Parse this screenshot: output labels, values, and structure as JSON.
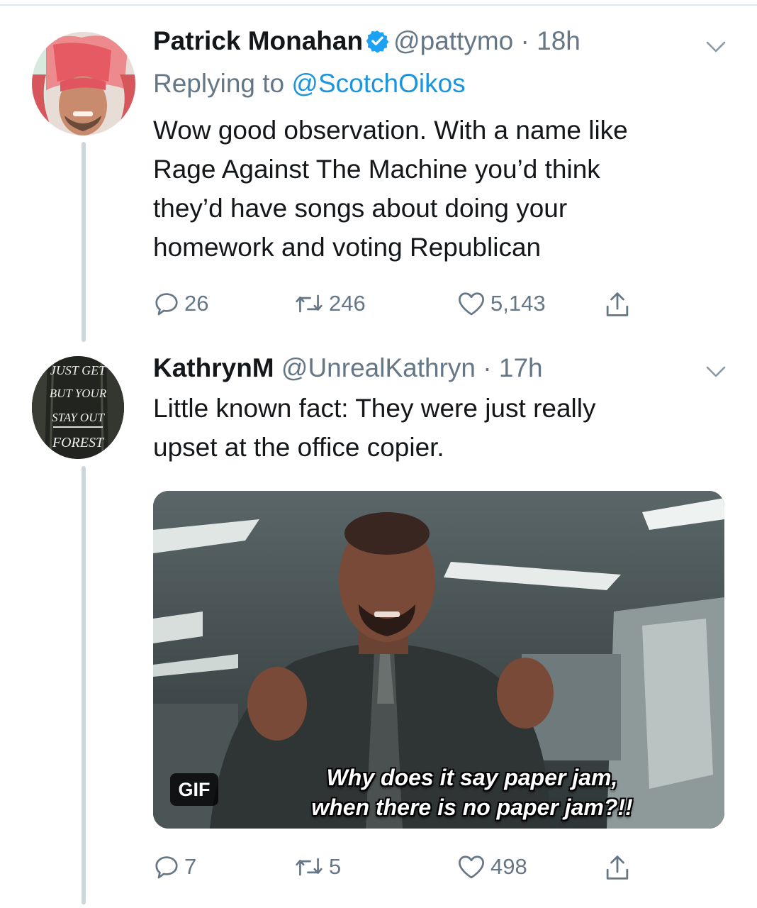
{
  "tweets": [
    {
      "display_name": "Patrick Monahan",
      "handle": "@pattymo",
      "separator": "·",
      "time": "18h",
      "replying_prefix": "Replying to",
      "replying_to": "@ScotchOikos",
      "text_lines": [
        "Wow good observation. With a name like",
        "Rage Against The Machine you’d think",
        "they’d have songs about doing your",
        "homework and voting Republican"
      ],
      "stats": {
        "replies": "26",
        "retweets": "246",
        "likes": "5,143"
      },
      "avatar_icon": "hooded-person-avatar",
      "verified_icon": "verified-badge-icon"
    },
    {
      "display_name": "KathrynM",
      "handle": "@UnrealKathryn",
      "separator": "·",
      "time": "17h",
      "text_lines": [
        "Little known fact: They were just really",
        "upset at the office copier."
      ],
      "media": {
        "badge": "GIF",
        "caption_lines": [
          "Why does it say paper jam,",
          "when there is no paper jam?!!"
        ]
      },
      "stats": {
        "replies": "7",
        "retweets": "5",
        "likes": "498"
      },
      "avatar": {
        "lines": [
          "JUST GET",
          "BUT YOUR",
          "STAY OUT",
          "FOREST"
        ]
      }
    }
  ],
  "colors": {
    "text": "#14171a",
    "secondary": "#657786",
    "link": "#1b95e0",
    "verified": "#1da1f2",
    "thread_line": "#ccd6dd"
  }
}
